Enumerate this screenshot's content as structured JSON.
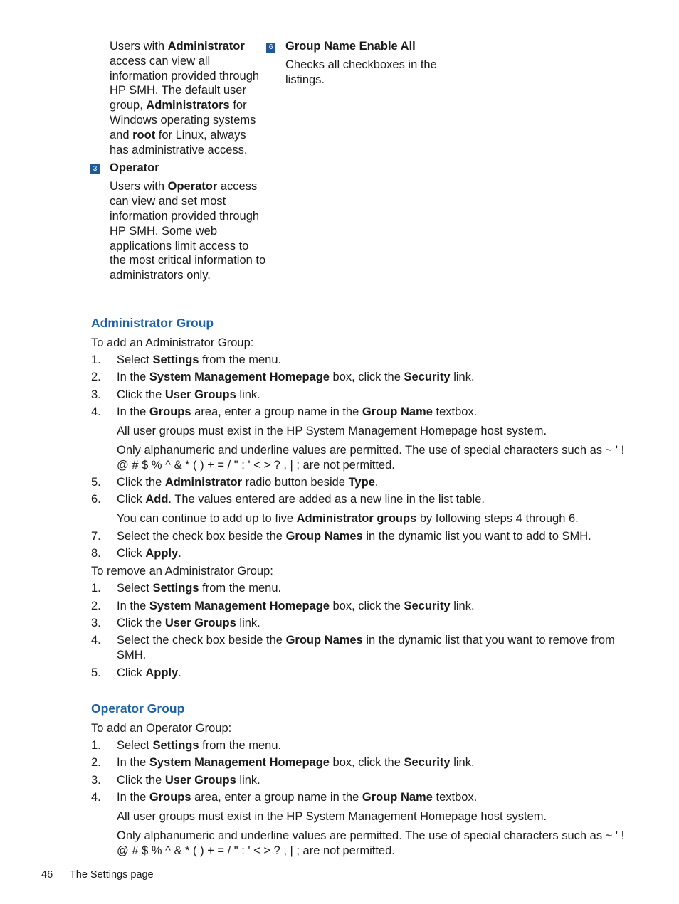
{
  "callouts_left": {
    "admin_desc": [
      "Users with ",
      {
        "b": "Administrator"
      },
      " access can view all information provided through HP SMH. The default user group, ",
      {
        "b": "Administrators"
      },
      " for Windows operating systems and ",
      {
        "b": "root"
      },
      " for Linux, always has administrative access."
    ],
    "operator": {
      "number": "3",
      "title": "Operator",
      "desc": [
        "Users with ",
        {
          "b": "Operator"
        },
        " access can view and set most information provided through HP SMH. Some web applications limit access to the most critical information to administrators only."
      ]
    }
  },
  "callouts_right": {
    "enable_all": {
      "number": "6",
      "title": "Group Name Enable All",
      "desc": [
        "Checks all checkboxes in the listings."
      ]
    }
  },
  "colors": {
    "heading": "#1f62a3",
    "callout_badge": "#1e5a96"
  },
  "admin_section": {
    "heading": "Administrator Group",
    "add_intro": "To add an Administrator Group:",
    "add_steps": [
      {
        "n": "1.",
        "text": [
          "Select ",
          {
            "b": "Settings"
          },
          " from the menu."
        ]
      },
      {
        "n": "2.",
        "text": [
          "In the ",
          {
            "b": "System Management Homepage"
          },
          " box, click the ",
          {
            "b": "Security"
          },
          " link."
        ]
      },
      {
        "n": "3.",
        "text": [
          "Click the ",
          {
            "b": "User Groups"
          },
          " link."
        ]
      },
      {
        "n": "4.",
        "text": [
          "In the ",
          {
            "b": "Groups"
          },
          " area, enter a group name in the ",
          {
            "b": "Group Name"
          },
          " textbox."
        ],
        "notes": [
          [
            "All user groups must exist in the HP System Management Homepage host system."
          ],
          [
            "Only alphanumeric and underline values are permitted. The use of special characters such as ~ ' ! @ # $ % ^ & * ( ) + = / \" : ' < > ? , | ; are not permitted."
          ]
        ]
      },
      {
        "n": "5.",
        "text": [
          "Click the ",
          {
            "b": "Administrator"
          },
          " radio button beside ",
          {
            "b": "Type"
          },
          "."
        ]
      },
      {
        "n": "6.",
        "text": [
          "Click ",
          {
            "b": "Add"
          },
          ". The values entered are added as a new line in the list table."
        ],
        "notes": [
          [
            "You can continue to add up to five ",
            {
              "b": "Administrator groups"
            },
            " by following steps 4 through 6."
          ]
        ]
      },
      {
        "n": "7.",
        "text": [
          "Select the check box beside the ",
          {
            "b": "Group Names"
          },
          " in the dynamic list you want to add to SMH."
        ]
      },
      {
        "n": "8.",
        "text": [
          "Click ",
          {
            "b": "Apply"
          },
          "."
        ]
      }
    ],
    "remove_intro": "To remove an Administrator Group:",
    "remove_steps": [
      {
        "n": "1.",
        "text": [
          "Select ",
          {
            "b": "Settings"
          },
          " from the menu."
        ]
      },
      {
        "n": "2.",
        "text": [
          "In the ",
          {
            "b": "System Management Homepage"
          },
          " box, click the ",
          {
            "b": "Security"
          },
          " link."
        ]
      },
      {
        "n": "3.",
        "text": [
          "Click the ",
          {
            "b": "User Groups"
          },
          " link."
        ]
      },
      {
        "n": "4.",
        "text": [
          "Select the check box beside the ",
          {
            "b": "Group Names"
          },
          " in the dynamic list that you want to remove from SMH."
        ]
      },
      {
        "n": "5.",
        "text": [
          "Click ",
          {
            "b": "Apply"
          },
          "."
        ]
      }
    ]
  },
  "operator_section": {
    "heading": "Operator Group",
    "add_intro": "To add an Operator Group:",
    "add_steps": [
      {
        "n": "1.",
        "text": [
          "Select ",
          {
            "b": "Settings"
          },
          " from the menu."
        ]
      },
      {
        "n": "2.",
        "text": [
          "In the ",
          {
            "b": "System Management Homepage"
          },
          " box, click the ",
          {
            "b": "Security"
          },
          " link."
        ]
      },
      {
        "n": "3.",
        "text": [
          "Click the ",
          {
            "b": "User Groups"
          },
          " link."
        ]
      },
      {
        "n": "4.",
        "text": [
          "In the ",
          {
            "b": "Groups"
          },
          " area, enter a group name in the ",
          {
            "b": "Group Name"
          },
          " textbox."
        ],
        "notes": [
          [
            "All user groups must exist in the HP System Management Homepage host system."
          ],
          [
            "Only alphanumeric and underline values are permitted. The use of special characters such as ~ ' ! @ # $ % ^ & * ( ) + = / \" : ' < > ? , | ; are not permitted."
          ]
        ]
      }
    ]
  },
  "footer": {
    "page_number": "46",
    "section": "The Settings page"
  }
}
